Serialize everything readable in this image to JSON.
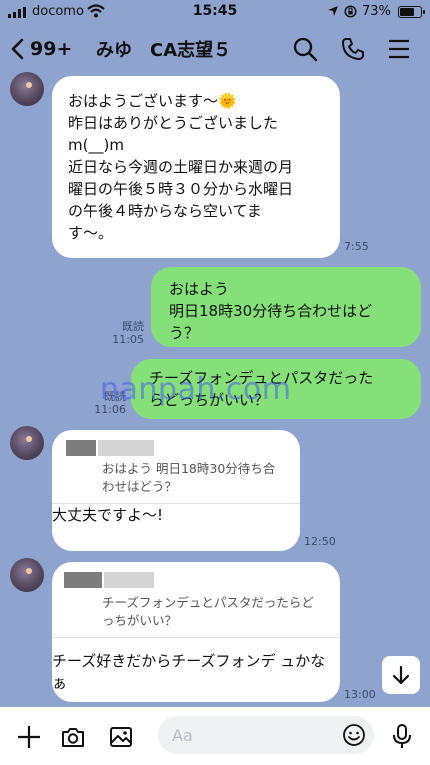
{
  "status_bar": {
    "carrier": "docomo",
    "time": "15:45",
    "battery_percent": "73%",
    "battery_level": 0.73
  },
  "header": {
    "unread_count": "99+",
    "title": "みゆ　CA志望５"
  },
  "messages": [
    {
      "text": "おはようございます〜🌞\n昨日はありがとうございました\nm(__)m\n近日なら今週の土曜日か来週の月\n曜日の午後５時３０分から水曜日\nの午後４時からなら空いてま\nす〜。",
      "time": "7:55"
    },
    {
      "text": "おはよう\n明日18時30分待ち合わせはど\nう？",
      "read": "既読",
      "time": "11:05"
    },
    {
      "text": "チーズフォンデュとパスタだった\nらどっちがいい？",
      "read": "既読",
      "time": "11:06"
    },
    {
      "quote": "おはよう 明日18時30分待ち合\nわせはどう？",
      "text": "大丈夫ですよ〜!",
      "time": "12:50"
    },
    {
      "quote": "チーズフォンデュとパスタだったらど\nっちがいい？",
      "text": "チーズ好きだからチーズフォンデ\nュかなぁ",
      "time": "13:00"
    }
  ],
  "watermark": "nanpah.com",
  "input": {
    "placeholder": "Aa"
  }
}
